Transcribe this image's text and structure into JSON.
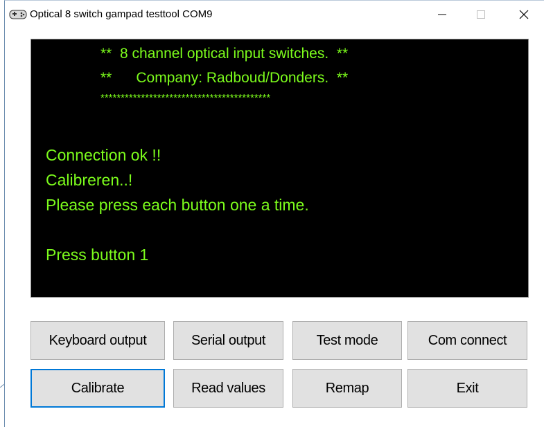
{
  "window": {
    "title": "Optical 8 switch gampad testtool  COM9",
    "icon": "gamepad-icon",
    "controls": {
      "minimize": "—",
      "maximize": "☐",
      "close": "✕"
    }
  },
  "console": {
    "header_lines": [
      "**  8 channel optical input switches.  **",
      "**      Company: Radboud/Donders.  **",
      "******************************************"
    ],
    "messages": [
      "Connection ok !!",
      "Calibreren..!",
      "Please press each button one a time.",
      "Press button 1"
    ],
    "text_color": "#7cfc1c",
    "background": "#000000"
  },
  "buttons": {
    "keyboard_output": "Keyboard output",
    "serial_output": "Serial output",
    "test_mode": "Test mode",
    "com_connect": "Com connect",
    "calibrate": "Calibrate",
    "read_values": "Read values",
    "remap": "Remap",
    "exit": "Exit"
  },
  "colors": {
    "focus_border": "#0078d7",
    "button_face": "#e1e1e1"
  }
}
